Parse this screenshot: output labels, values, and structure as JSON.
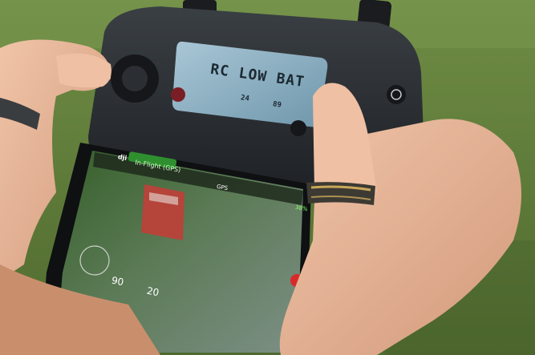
{
  "lcd": {
    "main": "RC LOW BAT",
    "reading_1": "24",
    "reading_2": "89"
  },
  "phone": {
    "logo": "dji",
    "flight_mode": "In-Flight (GPS)",
    "gps_label": "GPS",
    "battery": "38%",
    "altitude": "90",
    "distance": "20"
  },
  "colors": {
    "grass": "#5f7a3a",
    "controller": "#2b2f33",
    "lcd": "#8fb3c7",
    "skin": "#e7b79a",
    "screen_green": "#2f8f2f"
  }
}
